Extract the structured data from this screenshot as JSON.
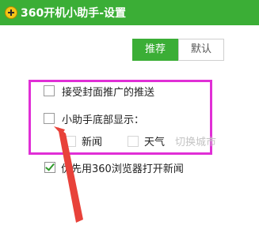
{
  "window": {
    "title": "360开机小助手-设置"
  },
  "tabs": [
    {
      "label": "推荐",
      "active": true
    },
    {
      "label": "默认",
      "active": false
    }
  ],
  "options": {
    "accept_cover_push": {
      "label": "接受封面推广的推送",
      "checked": false
    },
    "bottom_display": {
      "label": "小助手底部显示：",
      "checked": false
    },
    "news": {
      "label": "新闻",
      "checked": false,
      "enabled": false
    },
    "weather": {
      "label": "天气",
      "checked": false,
      "enabled": false
    },
    "switch_city": {
      "label": "切换城市",
      "enabled": false
    },
    "open_with_360_browser": {
      "label": "优先用360浏览器打开新闻",
      "checked": true
    }
  },
  "colors": {
    "brand_green": "#3bae36",
    "highlight_magenta": "#e02fd6",
    "annotation_red": "#e8423a"
  }
}
